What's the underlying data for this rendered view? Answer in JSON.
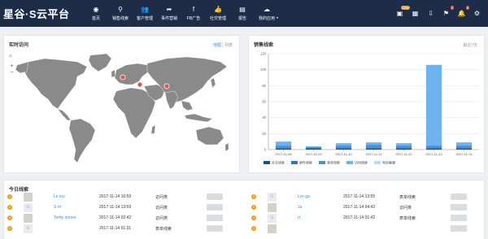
{
  "app": {
    "logo": "星谷·S云平台"
  },
  "nav": {
    "items": [
      {
        "label": "首页",
        "icon": "dashboard-icon"
      },
      {
        "label": "销售线索",
        "icon": "link-icon"
      },
      {
        "label": "客户管理",
        "icon": "users-icon"
      },
      {
        "label": "事件营销",
        "icon": "share-icon"
      },
      {
        "label": "FB广告",
        "icon": "facebook-icon"
      },
      {
        "label": "社交管理",
        "icon": "like-icon"
      },
      {
        "label": "报告",
        "icon": "report-icon"
      },
      {
        "label": "我的应用",
        "icon": "cloud-icon",
        "caret": "▾"
      }
    ]
  },
  "topright": {
    "items": [
      {
        "name": "notification-icon",
        "badge": "2250"
      },
      {
        "name": "news-icon",
        "badge": ""
      },
      {
        "name": "download-icon",
        "badge": ""
      },
      {
        "name": "cart-icon",
        "badge": "1"
      },
      {
        "name": "bell-icon",
        "badge": "6"
      },
      {
        "name": "gear-icon",
        "badge": ""
      }
    ]
  },
  "realtime": {
    "title": "实时访问",
    "view_map": "地图",
    "view_sep": "|",
    "view_list": "列表"
  },
  "sales": {
    "title": "销售线索",
    "range": "最近7天"
  },
  "chart_data": {
    "type": "bar",
    "stacked": true,
    "categories": [
      "2017-11-08",
      "2017-11-09",
      "2017-11-10",
      "2017-11-11",
      "2017-11-12",
      "2017-11-13",
      "2017-11-14"
    ],
    "ylim": [
      0,
      120
    ],
    "yticks": [
      0,
      20,
      40,
      60,
      80,
      100,
      120
    ],
    "grid": true,
    "legend_position": "bottom",
    "series": [
      {
        "name": "社交线索",
        "color": "#1f4e8c",
        "values": [
          1,
          1,
          1,
          1,
          1,
          1,
          1
        ]
      },
      {
        "name": "邮件线索",
        "color": "#2e74c0",
        "values": [
          1,
          1,
          1,
          1,
          1,
          1,
          1
        ]
      },
      {
        "name": "表单线索",
        "color": "#4a90d9",
        "values": [
          3,
          1,
          3,
          4,
          3,
          3,
          3
        ]
      },
      {
        "name": "访问线索",
        "color": "#6db3ef",
        "values": [
          5,
          1,
          3,
          3,
          3,
          101,
          4
        ]
      },
      {
        "name": "电话客服",
        "color": "#b8dcf7",
        "values": [
          0,
          0,
          0,
          0,
          0,
          0,
          0
        ]
      }
    ]
  },
  "today": {
    "title": "今日线索",
    "rows": [
      {
        "rank": "1",
        "name": "Le         iou",
        "time": "2017-11-14 16:59",
        "kind": "访问类",
        "avatar": "photo"
      },
      {
        "rank": "2",
        "name": "S          nf",
        "time": "2017-11-14 13:59",
        "kind": "访问类",
        "avatar": "generic"
      },
      {
        "rank": "3",
        "name": "Tertty       onnen",
        "time": "2017-11-14 02:42",
        "kind": "访问类",
        "avatar": "photo"
      },
      {
        "rank": "4",
        "name": "",
        "time": "2017-11-14 01:31",
        "kind": "表单线索",
        "avatar": "generic"
      },
      {
        "rank": "1",
        "name": "Lyn        ga",
        "time": "2017-11-14 13:55",
        "kind": "表单线索",
        "avatar": "generic"
      },
      {
        "rank": "2",
        "name": "Ja",
        "time": "2017-11-14 04:42",
        "kind": "访问类",
        "avatar": "photo"
      },
      {
        "rank": "3",
        "name": "          rt",
        "time": "2017-11-14 01:42",
        "kind": "表单线索",
        "avatar": "generic"
      },
      {
        "rank": "4",
        "name": "",
        "time": "",
        "kind": "",
        "avatar": "photo"
      }
    ]
  }
}
